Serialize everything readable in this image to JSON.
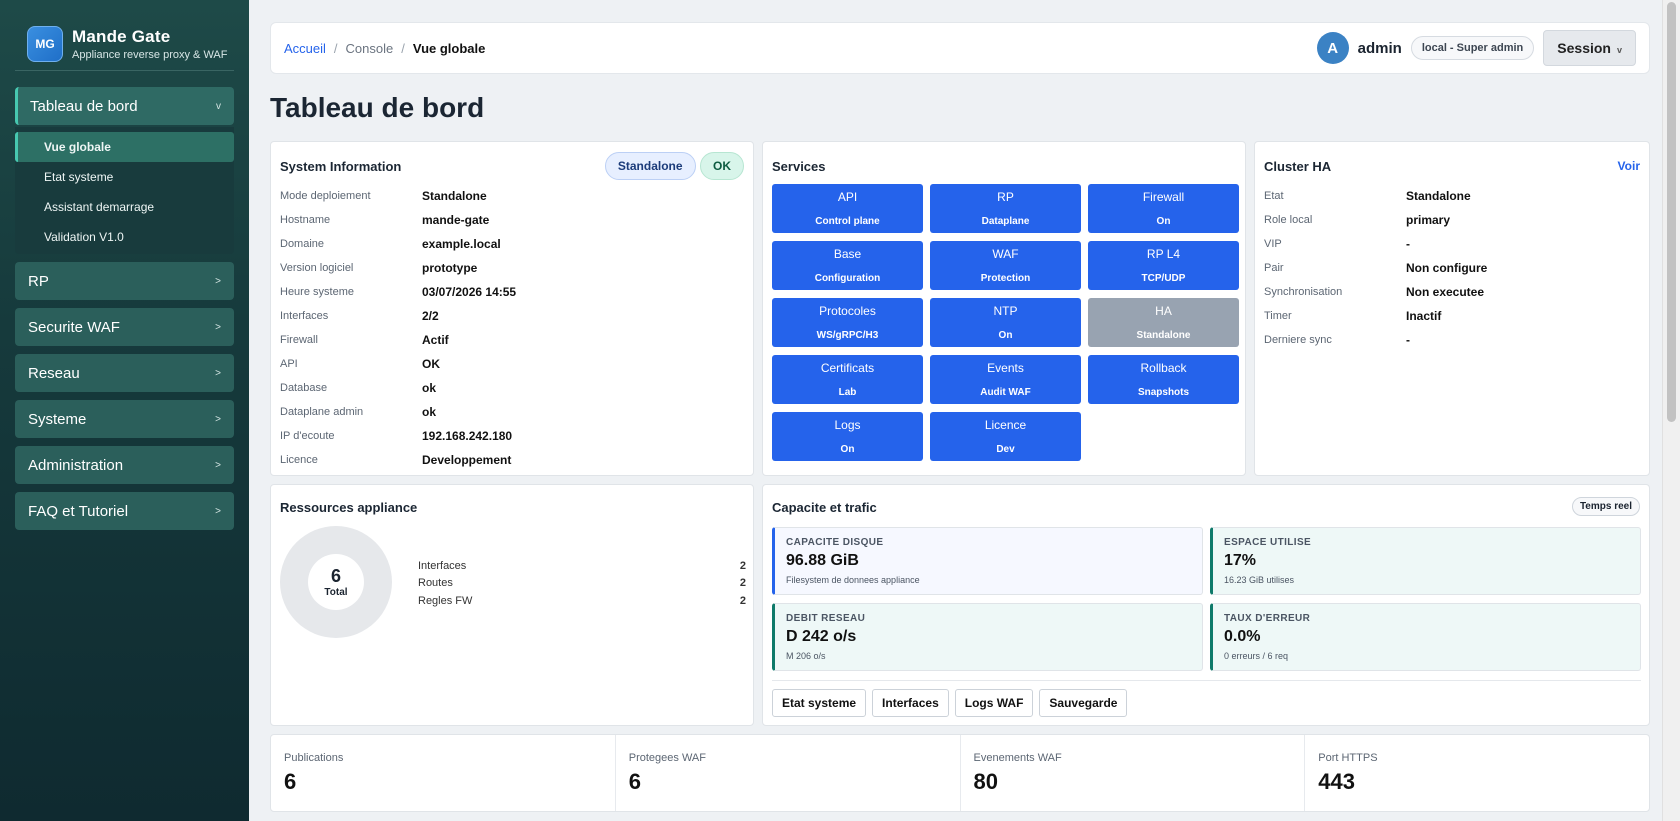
{
  "brand": {
    "logo": "MG",
    "name": "Mande Gate",
    "subtitle": "Appliance reverse proxy & WAF"
  },
  "sidebar": {
    "groups": [
      {
        "label": "Tableau de bord",
        "chevron": "v",
        "open": true,
        "items": [
          {
            "label": "Vue globale",
            "active": true
          },
          {
            "label": "Etat systeme"
          },
          {
            "label": "Assistant demarrage"
          },
          {
            "label": "Validation V1.0"
          }
        ]
      },
      {
        "label": "RP",
        "chevron": ">"
      },
      {
        "label": "Securite WAF",
        "chevron": ">"
      },
      {
        "label": "Reseau",
        "chevron": ">"
      },
      {
        "label": "Systeme",
        "chevron": ">"
      },
      {
        "label": "Administration",
        "chevron": ">"
      },
      {
        "label": "FAQ et Tutoriel",
        "chevron": ">"
      }
    ]
  },
  "header": {
    "breadcrumb": {
      "home": "Accueil",
      "section": "Console",
      "current": "Vue globale",
      "sep": "/"
    },
    "user": {
      "initial": "A",
      "name": "admin",
      "role": "local - Super admin"
    },
    "session_label": "Session",
    "session_chevron": "v"
  },
  "page_title": "Tableau de bord",
  "system_info": {
    "title": "System Information",
    "badge_mode": "Standalone",
    "badge_status": "OK",
    "rows": [
      {
        "k": "Mode deploiement",
        "v": "Standalone"
      },
      {
        "k": "Hostname",
        "v": "mande-gate"
      },
      {
        "k": "Domaine",
        "v": "example.local"
      },
      {
        "k": "Version logiciel",
        "v": "prototype"
      },
      {
        "k": "Heure systeme",
        "v": "03/07/2026 14:55"
      },
      {
        "k": "Interfaces",
        "v": "2/2"
      },
      {
        "k": "Firewall",
        "v": "Actif"
      },
      {
        "k": "API",
        "v": "OK"
      },
      {
        "k": "Database",
        "v": "ok"
      },
      {
        "k": "Dataplane admin",
        "v": "ok"
      },
      {
        "k": "IP d'ecoute",
        "v": "192.168.242.180"
      },
      {
        "k": "Licence",
        "v": "Developpement"
      }
    ]
  },
  "services": {
    "title": "Services",
    "tiles": [
      {
        "t": "API",
        "s": "Control plane"
      },
      {
        "t": "RP",
        "s": "Dataplane"
      },
      {
        "t": "Firewall",
        "s": "On"
      },
      {
        "t": "Base",
        "s": "Configuration"
      },
      {
        "t": "WAF",
        "s": "Protection"
      },
      {
        "t": "RP L4",
        "s": "TCP/UDP"
      },
      {
        "t": "Protocoles",
        "s": "WS/gRPC/H3"
      },
      {
        "t": "NTP",
        "s": "On"
      },
      {
        "t": "HA",
        "s": "Standalone",
        "disabled": true
      },
      {
        "t": "Certificats",
        "s": "Lab"
      },
      {
        "t": "Events",
        "s": "Audit WAF"
      },
      {
        "t": "Rollback",
        "s": "Snapshots"
      },
      {
        "t": "Logs",
        "s": "On"
      },
      {
        "t": "Licence",
        "s": "Dev"
      }
    ]
  },
  "cluster": {
    "title": "Cluster HA",
    "link": "Voir",
    "rows": [
      {
        "k": "Etat",
        "v": "Standalone"
      },
      {
        "k": "Role local",
        "v": "primary"
      },
      {
        "k": "VIP",
        "v": "-"
      },
      {
        "k": "Pair",
        "v": "Non configure"
      },
      {
        "k": "Synchronisation",
        "v": "Non executee"
      },
      {
        "k": "Timer",
        "v": "Inactif"
      },
      {
        "k": "Derniere sync",
        "v": "-"
      }
    ]
  },
  "resources": {
    "title": "Ressources appliance",
    "total_value": "6",
    "total_label": "Total",
    "items": [
      {
        "label": "Interfaces",
        "value": "2"
      },
      {
        "label": "Routes",
        "value": "2"
      },
      {
        "label": "Regles FW",
        "value": "2"
      }
    ]
  },
  "capacity": {
    "title": "Capacite et trafic",
    "realtime": "Temps reel",
    "metrics": [
      {
        "label": "CAPACITE DISQUE",
        "value": "96.88 GiB",
        "sub": "Filesystem de donnees appliance",
        "color": "#2563eb"
      },
      {
        "label": "ESPACE UTILISE",
        "value": "17%",
        "sub": "16.23 GiB utilises",
        "color": "#0f7a6a"
      },
      {
        "label": "DEBIT RESEAU",
        "value": "D 242 o/s",
        "sub": "M 206 o/s",
        "color": "#0f7a6a"
      },
      {
        "label": "TAUX D'ERREUR",
        "value": "0.0%",
        "sub": "0 erreurs / 6 req",
        "color": "#0f7a6a"
      }
    ],
    "actions": [
      "Etat systeme",
      "Interfaces",
      "Logs WAF",
      "Sauvegarde"
    ]
  },
  "stats": [
    {
      "label": "Publications",
      "value": "6"
    },
    {
      "label": "Protegees WAF",
      "value": "6"
    },
    {
      "label": "Evenements WAF",
      "value": "80"
    },
    {
      "label": "Port HTTPS",
      "value": "443"
    }
  ]
}
